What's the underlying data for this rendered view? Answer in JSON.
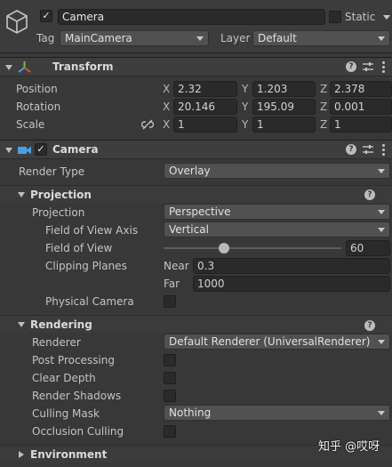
{
  "header": {
    "object_name": "Camera",
    "static_label": "Static",
    "tag_label": "Tag",
    "tag_value": "MainCamera",
    "layer_label": "Layer",
    "layer_value": "Default"
  },
  "transform": {
    "title": "Transform",
    "position": {
      "label": "Position",
      "x": "2.32",
      "y": "1.203",
      "z": "2.378"
    },
    "rotation": {
      "label": "Rotation",
      "x": "20.146",
      "y": "195.09",
      "z": "0.001"
    },
    "scale": {
      "label": "Scale",
      "x": "1",
      "y": "1",
      "z": "1"
    },
    "axis_x": "X",
    "axis_y": "Y",
    "axis_z": "Z"
  },
  "camera": {
    "title": "Camera",
    "render_type_label": "Render Type",
    "render_type_value": "Overlay",
    "projection_section": "Projection",
    "projection_label": "Projection",
    "projection_value": "Perspective",
    "fov_axis_label": "Field of View Axis",
    "fov_axis_value": "Vertical",
    "fov_label": "Field of View",
    "fov_value": "60",
    "fov_slider_fraction": 0.33,
    "clipping_label": "Clipping Planes",
    "near_label": "Near",
    "near_value": "0.3",
    "far_label": "Far",
    "far_value": "1000",
    "physical_camera_label": "Physical Camera",
    "rendering_section": "Rendering",
    "renderer_label": "Renderer",
    "renderer_value": "Default Renderer (UniversalRenderer)",
    "post_processing_label": "Post Processing",
    "clear_depth_label": "Clear Depth",
    "render_shadows_label": "Render Shadows",
    "culling_mask_label": "Culling Mask",
    "culling_mask_value": "Nothing",
    "occlusion_culling_label": "Occlusion Culling",
    "environment_section": "Environment"
  },
  "watermark": "知乎 @哎呀",
  "icons": {
    "cube": "gameobject-cube-icon",
    "transform": "transform-axes-icon",
    "camera": "camera-icon",
    "help": "help-icon",
    "presets": "presets-sliders-icon",
    "menu": "kebab-menu-icon",
    "link": "constrain-proportions-link-icon",
    "check": "✓",
    "help_glyph": "?"
  },
  "colors": {
    "background": "#383838",
    "field": "#2a2a2a",
    "dropdown": "#515151",
    "accent_blue": "#4b9fe0"
  }
}
